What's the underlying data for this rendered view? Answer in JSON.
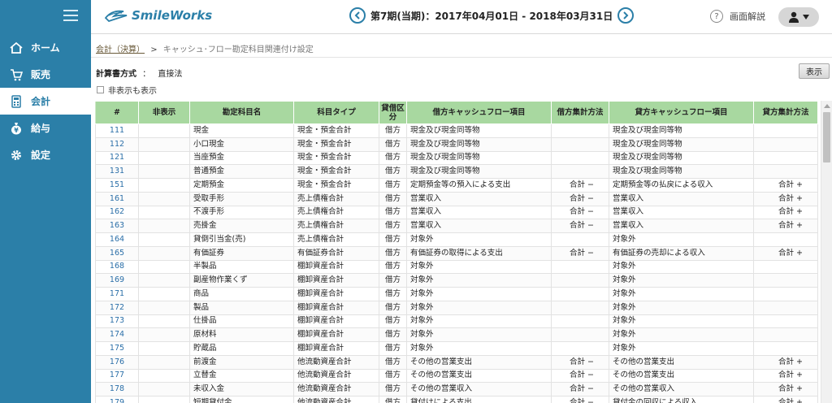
{
  "app": {
    "logo_text": "SmileWorks"
  },
  "header": {
    "period": "第7期(当期)：2017年04月01日 - 2018年03月31日",
    "help_label": "画面解説"
  },
  "sidebar": {
    "items": [
      {
        "label": "ホーム",
        "icon": "home-icon"
      },
      {
        "label": "販売",
        "icon": "cart-icon"
      },
      {
        "label": "会計",
        "icon": "calculator-icon"
      },
      {
        "label": "給与",
        "icon": "money-bag-icon"
      },
      {
        "label": "設定",
        "icon": "gear-icon"
      }
    ],
    "active_index": 2
  },
  "breadcrumb": {
    "parent": "会計（決算）",
    "separator": ">",
    "current": "キャッシュ･フロー勘定科目関連付け設定"
  },
  "method": {
    "label": "計算書方式",
    "colon": "：",
    "value": "直接法"
  },
  "toggle": {
    "label": "非表示も表示"
  },
  "display_button": "表示",
  "colors": {
    "sidebar": "#2b7fa8",
    "header_row": "#a8d8a0",
    "link": "#2b6fa8"
  },
  "table": {
    "columns": [
      "#",
      "非表示",
      "勘定科目名",
      "科目タイプ",
      "貸借区分",
      "借方キャッシュフロー項目",
      "借方集計方法",
      "貸方キャッシュフロー項目",
      "貸方集計方法"
    ],
    "rows": [
      [
        "111",
        "",
        "現金",
        "現金・預金合計",
        "借方",
        "現金及び現金同等物",
        "",
        "現金及び現金同等物",
        ""
      ],
      [
        "112",
        "",
        "小口現金",
        "現金・預金合計",
        "借方",
        "現金及び現金同等物",
        "",
        "現金及び現金同等物",
        ""
      ],
      [
        "121",
        "",
        "当座預金",
        "現金・預金合計",
        "借方",
        "現金及び現金同等物",
        "",
        "現金及び現金同等物",
        ""
      ],
      [
        "131",
        "",
        "普通預金",
        "現金・預金合計",
        "借方",
        "現金及び現金同等物",
        "",
        "現金及び現金同等物",
        ""
      ],
      [
        "151",
        "",
        "定期預金",
        "現金・預金合計",
        "借方",
        "定期預金等の預入による支出",
        "合計 −",
        "定期預金等の払戻による収入",
        "合計 +"
      ],
      [
        "161",
        "",
        "受取手形",
        "売上債権合計",
        "借方",
        "営業収入",
        "合計 −",
        "営業収入",
        "合計 +"
      ],
      [
        "162",
        "",
        "不渡手形",
        "売上債権合計",
        "借方",
        "営業収入",
        "合計 −",
        "営業収入",
        "合計 +"
      ],
      [
        "163",
        "",
        "売掛金",
        "売上債権合計",
        "借方",
        "営業収入",
        "合計 −",
        "営業収入",
        "合計 +"
      ],
      [
        "164",
        "",
        "貸倒引当金(売)",
        "売上債権合計",
        "借方",
        "対象外",
        "",
        "対象外",
        ""
      ],
      [
        "165",
        "",
        "有価証券",
        "有価証券合計",
        "借方",
        "有価証券の取得による支出",
        "合計 −",
        "有価証券の売却による収入",
        "合計 +"
      ],
      [
        "168",
        "",
        "半製品",
        "棚卸資産合計",
        "借方",
        "対象外",
        "",
        "対象外",
        ""
      ],
      [
        "169",
        "",
        "副産物作業くず",
        "棚卸資産合計",
        "借方",
        "対象外",
        "",
        "対象外",
        ""
      ],
      [
        "171",
        "",
        "商品",
        "棚卸資産合計",
        "借方",
        "対象外",
        "",
        "対象外",
        ""
      ],
      [
        "172",
        "",
        "製品",
        "棚卸資産合計",
        "借方",
        "対象外",
        "",
        "対象外",
        ""
      ],
      [
        "173",
        "",
        "仕掛品",
        "棚卸資産合計",
        "借方",
        "対象外",
        "",
        "対象外",
        ""
      ],
      [
        "174",
        "",
        "原材料",
        "棚卸資産合計",
        "借方",
        "対象外",
        "",
        "対象外",
        ""
      ],
      [
        "175",
        "",
        "貯蔵品",
        "棚卸資産合計",
        "借方",
        "対象外",
        "",
        "対象外",
        ""
      ],
      [
        "176",
        "",
        "前渡金",
        "他流動資産合計",
        "借方",
        "その他の営業支出",
        "合計 −",
        "その他の営業支出",
        "合計 +"
      ],
      [
        "177",
        "",
        "立替金",
        "他流動資産合計",
        "借方",
        "その他の営業支出",
        "合計 −",
        "その他の営業支出",
        "合計 +"
      ],
      [
        "178",
        "",
        "未収入金",
        "他流動資産合計",
        "借方",
        "その他の営業収入",
        "合計 −",
        "その他の営業収入",
        "合計 +"
      ],
      [
        "179",
        "",
        "短期貸付金",
        "他流動資産合計",
        "借方",
        "貸付けによる支出",
        "合計 −",
        "貸付金の回収による収入",
        "合計 +"
      ]
    ]
  }
}
